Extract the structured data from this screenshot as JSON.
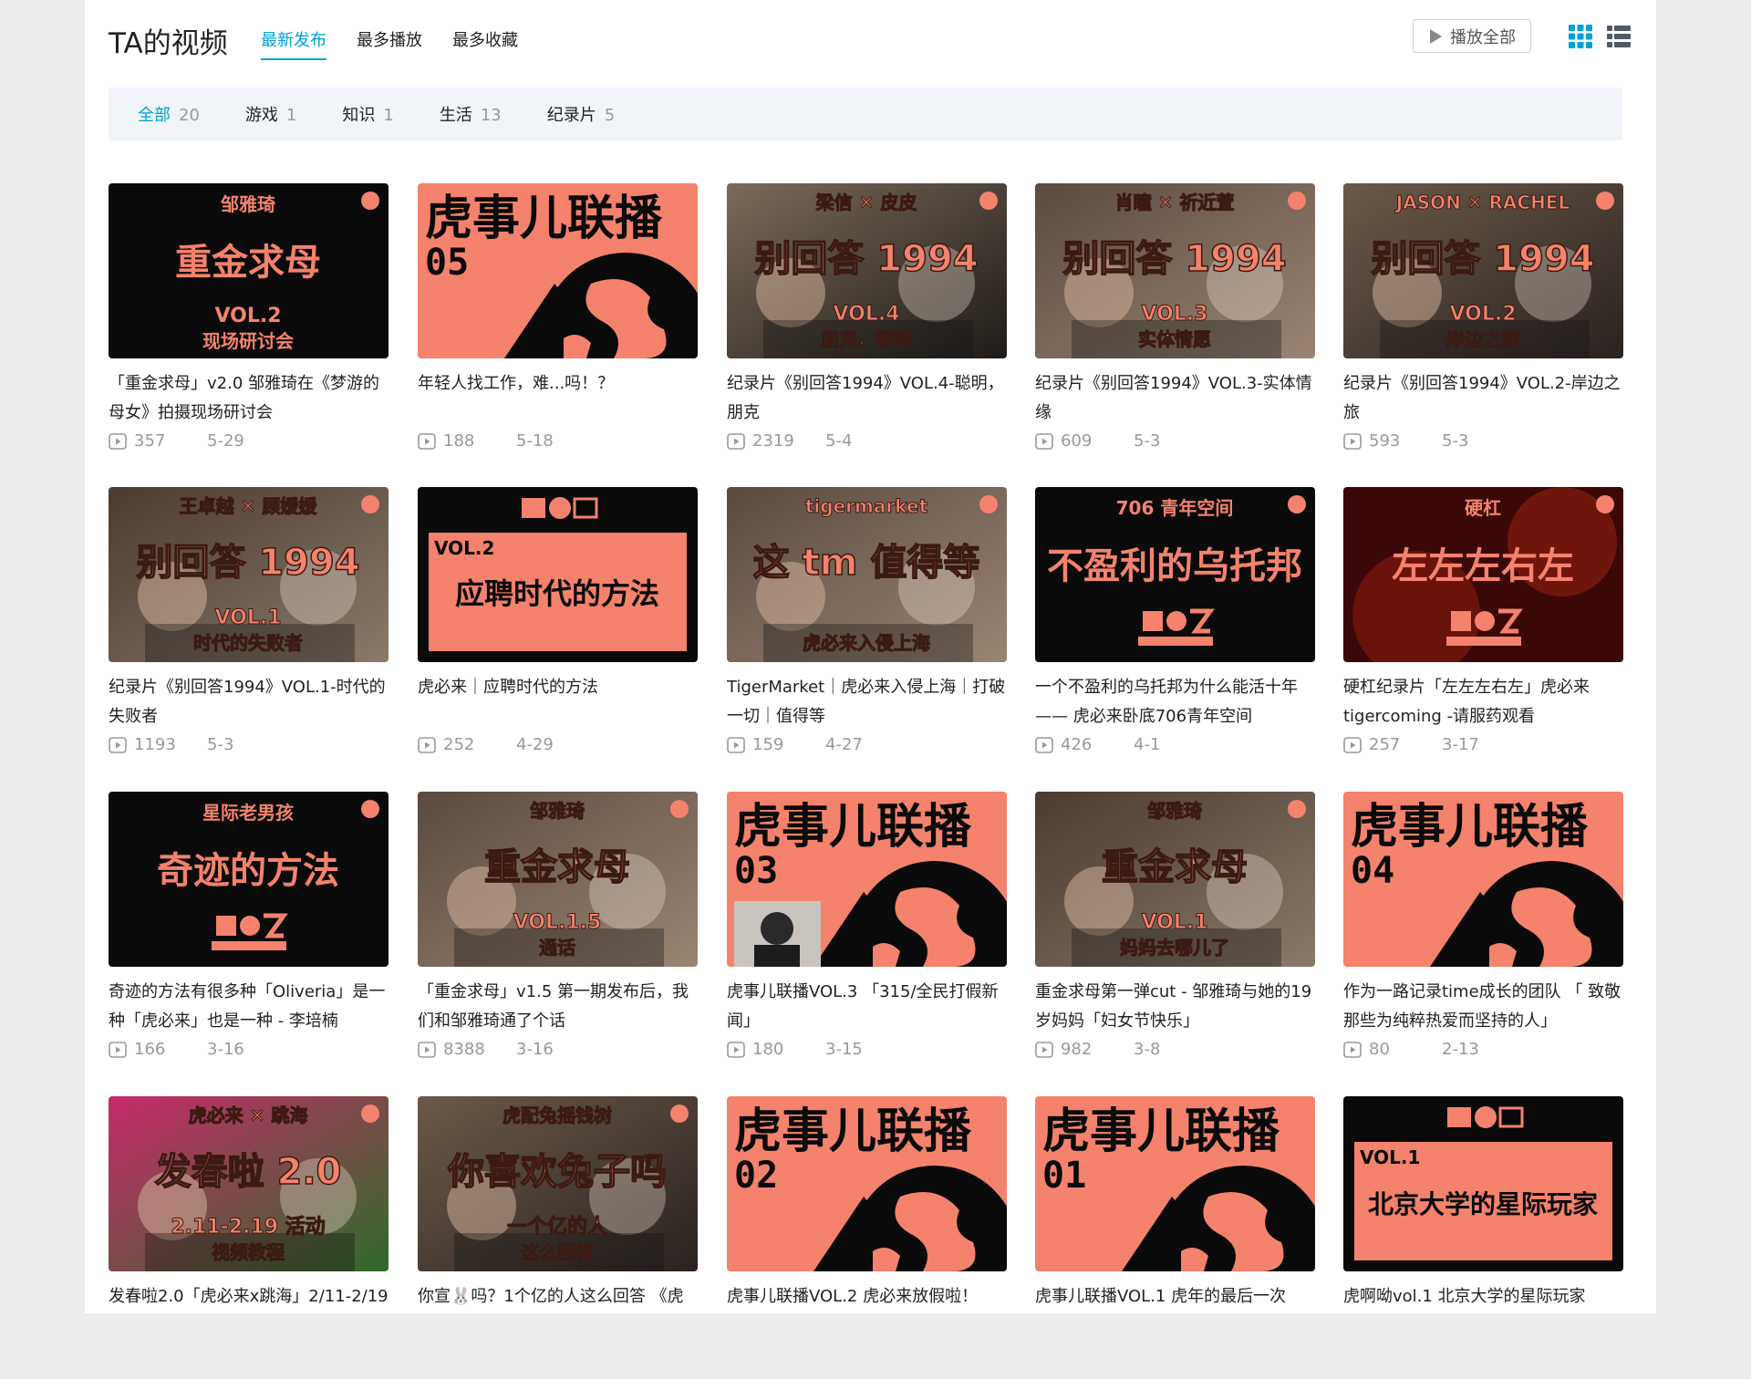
{
  "header": {
    "title": "TA的视频",
    "sort_tabs": [
      "最新发布",
      "最多播放",
      "最多收藏"
    ],
    "play_all": "播放全部"
  },
  "filters": [
    {
      "label": "全部",
      "count": "20"
    },
    {
      "label": "游戏",
      "count": "1"
    },
    {
      "label": "知识",
      "count": "1"
    },
    {
      "label": "生活",
      "count": "13"
    },
    {
      "label": "纪录片",
      "count": "5"
    }
  ],
  "colors": {
    "accent": "#00a1d6",
    "coral": "#f4826c",
    "black": "#0a0a0a"
  },
  "videos": [
    {
      "title": "「重金求母」v2.0 邹雅琦在《梦游的母女》拍摄现场研讨会",
      "views": "357",
      "date": "5-29",
      "thumb": {
        "style": "black",
        "top": "邹雅琦",
        "main": "重金求母",
        "sub1": "VOL.2",
        "sub2": "现场研讨会"
      }
    },
    {
      "title": "年轻人找工作，难...吗！？",
      "views": "188",
      "date": "5-18",
      "thumb": {
        "style": "coral-big",
        "top": "",
        "main": "虎事儿联播",
        "sub1": "05",
        "sub2": ""
      }
    },
    {
      "title": "纪录片《别回答1994》VOL.4-聪明，朋克",
      "views": "2319",
      "date": "5-4",
      "thumb": {
        "style": "photo",
        "top": "梁信 ✕ 皮皮",
        "main": "别回答 1994",
        "sub1": "VOL.4",
        "sub2": "朋克，聪明"
      }
    },
    {
      "title": "纪录片《别回答1994》VOL.3-实体情缘",
      "views": "609",
      "date": "5-3",
      "thumb": {
        "style": "photo",
        "top": "肖瞳 ✕ 祈近萱",
        "main": "别回答 1994",
        "sub1": "VOL.3",
        "sub2": "实体情愿"
      }
    },
    {
      "title": "纪录片《别回答1994》VOL.2-岸边之旅",
      "views": "593",
      "date": "5-3",
      "thumb": {
        "style": "photo",
        "top": "JASON ✕ RACHEL",
        "main": "别回答 1994",
        "sub1": "VOL.2",
        "sub2": "岸边之旅"
      }
    },
    {
      "title": "纪录片《别回答1994》VOL.1-时代的失败者",
      "views": "1193",
      "date": "5-3",
      "thumb": {
        "style": "photo",
        "top": "王卓越 ✕ 顾媛媛",
        "main": "别回答 1994",
        "sub1": "VOL.1",
        "sub2": "时代的失败者"
      }
    },
    {
      "title": "虎必来｜应聘时代的方法",
      "views": "252",
      "date": "4-29",
      "thumb": {
        "style": "box",
        "top": "",
        "main": "应聘时代的方法",
        "sub1": "VOL.2",
        "sub2": ""
      }
    },
    {
      "title": "TigerMarket｜虎必来入侵上海｜打破一切｜值得等",
      "views": "159",
      "date": "4-27",
      "thumb": {
        "style": "photo",
        "top": "tigermarket",
        "main": "这 tm 值得等",
        "sub1": "",
        "sub2": "虎必来入侵上海"
      }
    },
    {
      "title": "一个不盈利的乌托邦为什么能活十年 —— 虎必来卧底706青年空间",
      "views": "426",
      "date": "4-1",
      "thumb": {
        "style": "black",
        "top": "706 青年空间",
        "main": "不盈利的乌托邦",
        "sub1": "",
        "sub2": ""
      }
    },
    {
      "title": "硬杠纪录片「左左左右左」虎必来tigercoming -请服药观看",
      "views": "257",
      "date": "3-17",
      "thumb": {
        "style": "red",
        "top": "硬杠",
        "main": "左左左右左",
        "sub1": "",
        "sub2": ""
      }
    },
    {
      "title": "奇迹的方法有很多种「Oliveria」是一种「虎必来」也是一种 - 李培楠",
      "views": "166",
      "date": "3-16",
      "thumb": {
        "style": "black",
        "top": "星际老男孩",
        "main": "奇迹的方法",
        "sub1": "",
        "sub2": ""
      }
    },
    {
      "title": "「重金求母」v1.5 第一期发布后，我们和邹雅琦通了个话",
      "views": "8388",
      "date": "3-16",
      "thumb": {
        "style": "photo",
        "top": "邹雅琦",
        "main": "重金求母",
        "sub1": "VOL.1.5",
        "sub2": "通话"
      }
    },
    {
      "title": "虎事儿联播VOL.3 「315/全民打假新闻」",
      "views": "180",
      "date": "3-15",
      "thumb": {
        "style": "coral-big",
        "top": "",
        "main": "虎事儿联播",
        "sub1": "03",
        "sub2": ""
      }
    },
    {
      "title": "重金求母第一弹cut - 邹雅琦与她的19岁妈妈「妇女节快乐」",
      "views": "982",
      "date": "3-8",
      "thumb": {
        "style": "photo",
        "top": "邹雅琦",
        "main": "重金求母",
        "sub1": "VOL.1",
        "sub2": "妈妈去哪儿了"
      }
    },
    {
      "title": "作为一路记录time成长的团队 「 致敬那些为纯粹热爱而坚持的人」",
      "views": "80",
      "date": "2-13",
      "thumb": {
        "style": "coral-big",
        "top": "",
        "main": "虎事儿联播",
        "sub1": "04",
        "sub2": ""
      }
    },
    {
      "title": "发春啦2.0「虎必来x跳海」2/11-2/19",
      "views": "",
      "date": "",
      "thumb": {
        "style": "pink",
        "top": "虎必来 ✕ 跳海",
        "main": "发春啦 2.0",
        "sub1": "2.11-2.19 活动",
        "sub2": "视频教程"
      }
    },
    {
      "title": "你宣🐰吗？1个亿的人这么回答 《虎",
      "views": "",
      "date": "",
      "thumb": {
        "style": "photo",
        "top": "虎配兔摇钱树",
        "main": "你喜欢兔子吗",
        "sub1": "一个亿的人",
        "sub2": "这么回答"
      }
    },
    {
      "title": "虎事儿联播VOL.2 虎必来放假啦！",
      "views": "",
      "date": "",
      "thumb": {
        "style": "coral-big",
        "top": "",
        "main": "虎事儿联播",
        "sub1": "02",
        "sub2": ""
      }
    },
    {
      "title": "虎事儿联播VOL.1 虎年的最后一次",
      "views": "",
      "date": "",
      "thumb": {
        "style": "coral-big",
        "top": "",
        "main": "虎事儿联播",
        "sub1": "01",
        "sub2": ""
      }
    },
    {
      "title": "虎啊呦vol.1 北京大学的星际玩家",
      "views": "",
      "date": "",
      "thumb": {
        "style": "box",
        "top": "",
        "main": "北京大学的星际玩家",
        "sub1": "VOL.1",
        "sub2": ""
      }
    }
  ]
}
